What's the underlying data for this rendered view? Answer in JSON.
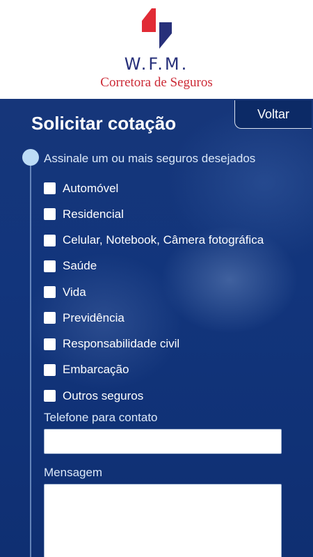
{
  "header": {
    "brand_name": "W.F.M.",
    "tagline": "Corretora de Seguros",
    "logo_icon": "wfm-logo-icon",
    "colors": {
      "logo_red": "#e12b35",
      "logo_blue": "#27307a"
    }
  },
  "toolbar": {
    "back_label": "Voltar"
  },
  "form": {
    "title": "Solicitar cotação",
    "insurance_prompt": "Assinale um ou mais seguros desejados",
    "options": [
      {
        "label": "Automóvel",
        "checked": false
      },
      {
        "label": "Residencial",
        "checked": false
      },
      {
        "label": "Celular, Notebook, Câmera fotográfica",
        "checked": false
      },
      {
        "label": "Saúde",
        "checked": false
      },
      {
        "label": "Vida",
        "checked": false
      },
      {
        "label": "Previdência",
        "checked": false
      },
      {
        "label": "Responsabilidade civil",
        "checked": false
      },
      {
        "label": "Embarcação",
        "checked": false
      },
      {
        "label": "Outros seguros",
        "checked": false
      }
    ],
    "phone_label": "Telefone para contato",
    "phone_value": "",
    "message_label": "Mensagem",
    "message_value": ""
  },
  "theme": {
    "background": "#12357c",
    "accent_dot": "#bcdcf6"
  }
}
